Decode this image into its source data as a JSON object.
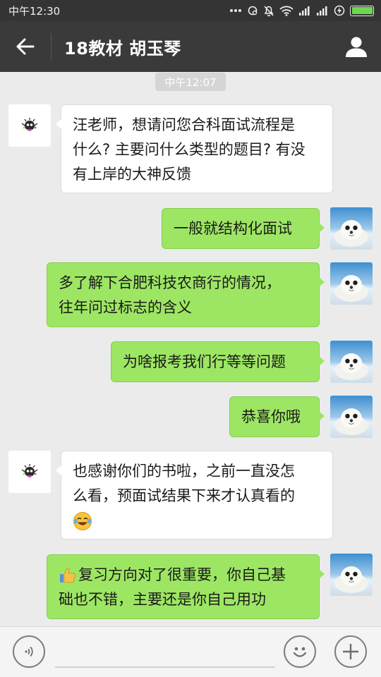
{
  "status_bar": {
    "time": "中午12:30",
    "battery_level": 1.0,
    "icons": [
      "more-dots-icon",
      "sync-icon",
      "mute-icon",
      "wifi-icon",
      "signal-icon",
      "signal-icon",
      "charging-icon",
      "battery-icon"
    ]
  },
  "header": {
    "title": "18教材 胡玉琴",
    "back_icon": "back-arrow-icon",
    "profile_icon": "person-icon"
  },
  "timestamp": "中午12:07",
  "messages": [
    {
      "side": "left",
      "lines": [
        "汪老师，想请问您合科面试流程是",
        "什么? 主要问什么类型的题目? 有没",
        "有上岸的大神反馈"
      ]
    },
    {
      "side": "right",
      "lines": [
        "一般就结构化面试"
      ]
    },
    {
      "side": "right",
      "lines": [
        "多了解下合肥科技农商行的情况，",
        "往年问过标志的含义"
      ]
    },
    {
      "side": "right",
      "lines": [
        "为啥报考我们行等等问题"
      ]
    },
    {
      "side": "right",
      "lines": [
        "恭喜你哦"
      ]
    },
    {
      "side": "left",
      "lines": [
        "也感谢你们的书啦，之前一直没怎",
        "么看，预面试结果下来才认真看的",
        ""
      ],
      "emoji": "laughing-crying-emoji"
    },
    {
      "side": "right",
      "lines": [
        "复习方向对了很重要，你自己基",
        "础也不错，主要还是你自己用功"
      ],
      "emoji": "thumbs-up-emoji"
    }
  ],
  "input_bar": {
    "voice_icon": "voice-icon",
    "emoji_icon": "smiley-icon",
    "add_icon": "plus-icon",
    "value": "",
    "placeholder": ""
  },
  "colors": {
    "status_bar_bg": "#343434",
    "title_bar_bg": "#3a3a3a",
    "chat_bg": "#ebebeb",
    "bubble_sent": "#9de663",
    "bubble_received": "#ffffff",
    "battery": "#6fd64f"
  }
}
